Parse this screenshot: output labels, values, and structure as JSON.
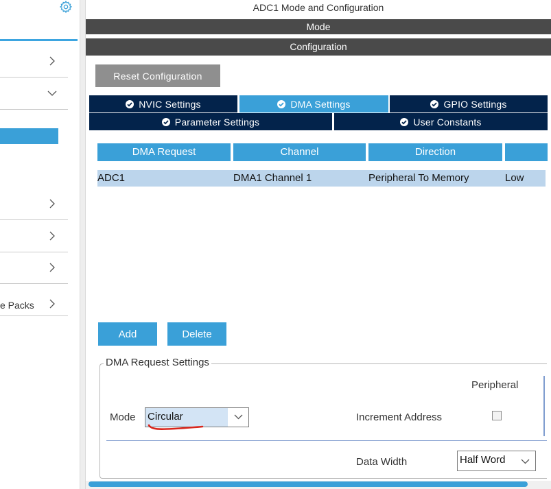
{
  "sidebar": {
    "items": [
      {
        "label": "",
        "chevron": "right"
      },
      {
        "label": "",
        "chevron": "down"
      },
      {
        "label": "",
        "chevron": "right"
      },
      {
        "label": "",
        "chevron": "right"
      },
      {
        "label": "",
        "chevron": "right"
      },
      {
        "label": "e Packs",
        "chevron": "right"
      }
    ]
  },
  "window": {
    "title": "ADC1 Mode and Configuration"
  },
  "sections": {
    "mode": "Mode",
    "configuration": "Configuration"
  },
  "toolbar": {
    "reset_label": "Reset Configuration"
  },
  "tabs": {
    "nvic": "NVIC Settings",
    "dma": "DMA Settings",
    "gpio": "GPIO Settings",
    "parameter": "Parameter Settings",
    "user_constants": "User Constants",
    "active": "dma"
  },
  "dma_table": {
    "columns": [
      "DMA Request",
      "Channel",
      "Direction",
      ""
    ],
    "rows": [
      [
        "ADC1",
        "DMA1 Channel 1",
        "Peripheral To Memory",
        "Low"
      ]
    ]
  },
  "actions": {
    "add_label": "Add",
    "delete_label": "Delete"
  },
  "request_settings": {
    "title": "DMA Request Settings",
    "peripheral_header": "Peripheral",
    "mode_label": "Mode",
    "mode_value": "Circular",
    "increment_label": "Increment Address",
    "increment_checked": false,
    "data_width_label": "Data Width",
    "data_width_value": "Half Word"
  },
  "colors": {
    "accent": "#3aa0d8",
    "tab_dark": "#03234b",
    "header_bar": "#4a4a4a",
    "row_selected": "#bcd5ec",
    "annotation_red": "#d9261c"
  },
  "icons": {
    "settings": "gear-icon",
    "tab_status": "check-circle-icon",
    "expand": "chevron-right-icon",
    "collapse": "chevron-down-icon",
    "dropdown": "chevron-down-icon"
  }
}
